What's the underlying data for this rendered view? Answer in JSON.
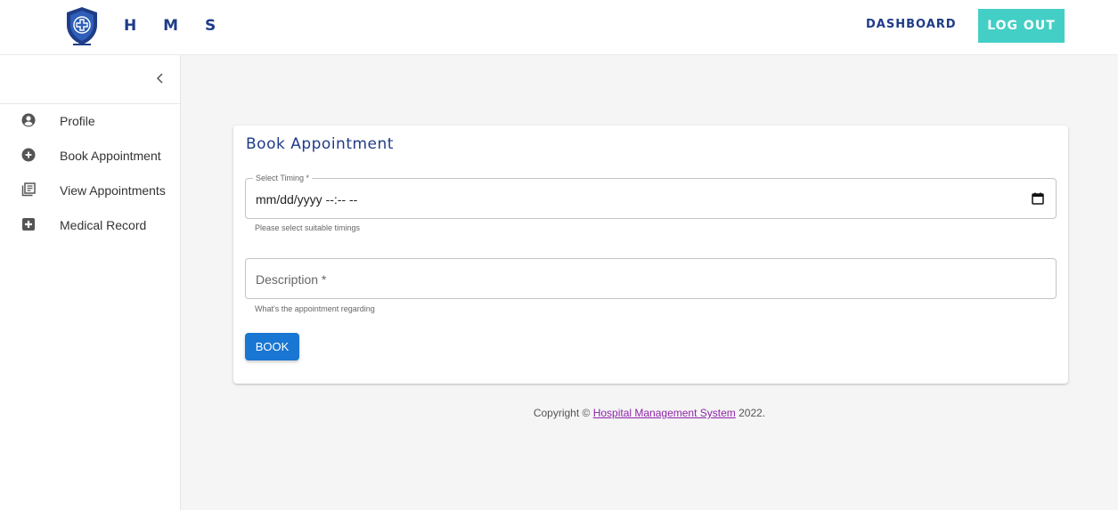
{
  "header": {
    "brand": "H M S",
    "nav_dashboard": "DASHBOARD",
    "logout": "LOG OUT",
    "accent_color": "#43cfc6",
    "brand_color": "#1f3c88"
  },
  "sidebar": {
    "items": [
      {
        "label": "Profile",
        "icon": "account-circle-icon"
      },
      {
        "label": "Book Appointment",
        "icon": "add-circle-icon"
      },
      {
        "label": "View Appointments",
        "icon": "library-books-icon"
      },
      {
        "label": "Medical Record",
        "icon": "medical-cross-icon"
      }
    ]
  },
  "form": {
    "title": "Book Appointment",
    "timing": {
      "label": "Select Timing *",
      "value": "mm/dd/yyyy --:-- --",
      "helper": "Please select suitable timings"
    },
    "description": {
      "placeholder": "Description *",
      "helper": "What's the appointment regarding"
    },
    "submit": "BOOK",
    "submit_color": "#1976d2"
  },
  "footer": {
    "prefix": "Copyright © ",
    "link": "Hospital Management System",
    "suffix": " 2022."
  }
}
